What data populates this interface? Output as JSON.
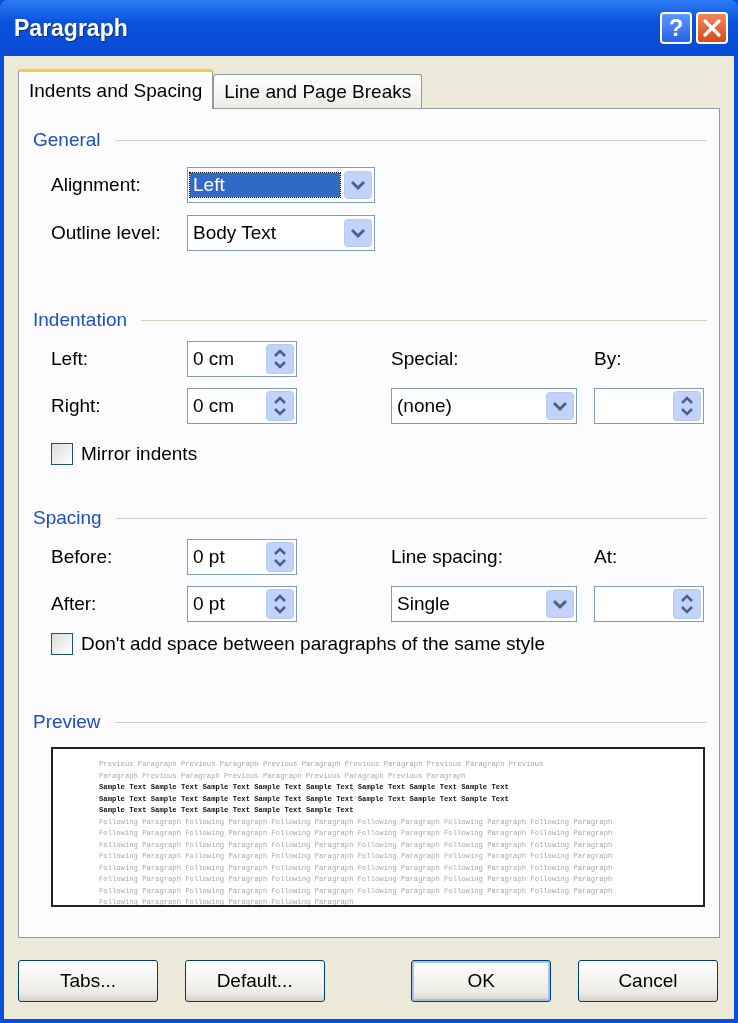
{
  "window": {
    "title": "Paragraph",
    "help": "?"
  },
  "tabs": [
    {
      "label": "Indents and Spacing",
      "selected": true
    },
    {
      "label": "Line and Page Breaks",
      "selected": false
    }
  ],
  "general": {
    "heading": "General",
    "alignment": {
      "label": "Alignment:",
      "value": "Left",
      "highlighted": true
    },
    "outline_level": {
      "label": "Outline level:",
      "value": "Body Text",
      "highlighted": false
    }
  },
  "indentation": {
    "heading": "Indentation",
    "left": {
      "label": "Left:",
      "value": "0 cm"
    },
    "right": {
      "label": "Right:",
      "value": "0 cm"
    },
    "special": {
      "label": "Special:",
      "value": "(none)"
    },
    "by": {
      "label": "By:"
    },
    "mirror_indents": {
      "label": "Mirror indents",
      "checked": false
    }
  },
  "spacing": {
    "heading": "Spacing",
    "before": {
      "label": "Before:",
      "value": "0 pt"
    },
    "after": {
      "label": "After:",
      "value": "0 pt"
    },
    "line_spacing": {
      "label": "Line spacing:",
      "value": "Single"
    },
    "at": {
      "label": "At:"
    },
    "dont_add_space": {
      "label": "Don't add space between paragraphs of the same style",
      "checked": false
    }
  },
  "preview": {
    "heading": "Preview",
    "lines": [
      {
        "kind": "previous",
        "text": "Previous Paragraph Previous Paragraph Previous Paragraph Previous Paragraph Previous Paragraph Previous"
      },
      {
        "kind": "previous",
        "text": "Paragraph Previous Paragraph Previous Paragraph Previous Paragraph Previous Paragraph"
      },
      {
        "kind": "sample",
        "text": "Sample Text Sample Text Sample Text Sample Text Sample Text Sample Text Sample Text Sample Text"
      },
      {
        "kind": "sample",
        "text": "Sample Text Sample Text Sample Text Sample Text Sample Text Sample Text Sample Text Sample Text"
      },
      {
        "kind": "sample",
        "text": "Sample Text Sample Text Sample Text Sample Text Sample Text"
      },
      {
        "kind": "following",
        "text": "Following Paragraph Following Paragraph Following Paragraph Following Paragraph Following Paragraph Following Paragraph"
      },
      {
        "kind": "following",
        "text": "Following Paragraph Following Paragraph Following Paragraph Following Paragraph Following Paragraph Following Paragraph"
      },
      {
        "kind": "following",
        "text": "Following Paragraph Following Paragraph Following Paragraph Following Paragraph Following Paragraph Following Paragraph"
      },
      {
        "kind": "following",
        "text": "Following Paragraph Following Paragraph Following Paragraph Following Paragraph Following Paragraph Following Paragraph"
      },
      {
        "kind": "following",
        "text": "Following Paragraph Following Paragraph Following Paragraph Following Paragraph Following Paragraph Following Paragraph"
      },
      {
        "kind": "following",
        "text": "Following Paragraph Following Paragraph Following Paragraph Following Paragraph Following Paragraph Following Paragraph"
      },
      {
        "kind": "following",
        "text": "Following Paragraph Following Paragraph Following Paragraph Following Paragraph Following Paragraph Following Paragraph"
      },
      {
        "kind": "following",
        "text": "Following Paragraph Following Paragraph Following Paragraph"
      }
    ]
  },
  "buttons": [
    {
      "label": "Tabs...",
      "default": false
    },
    {
      "label": "Default...",
      "default": false
    },
    {
      "label": "OK",
      "default": true
    },
    {
      "label": "Cancel",
      "default": false
    }
  ]
}
